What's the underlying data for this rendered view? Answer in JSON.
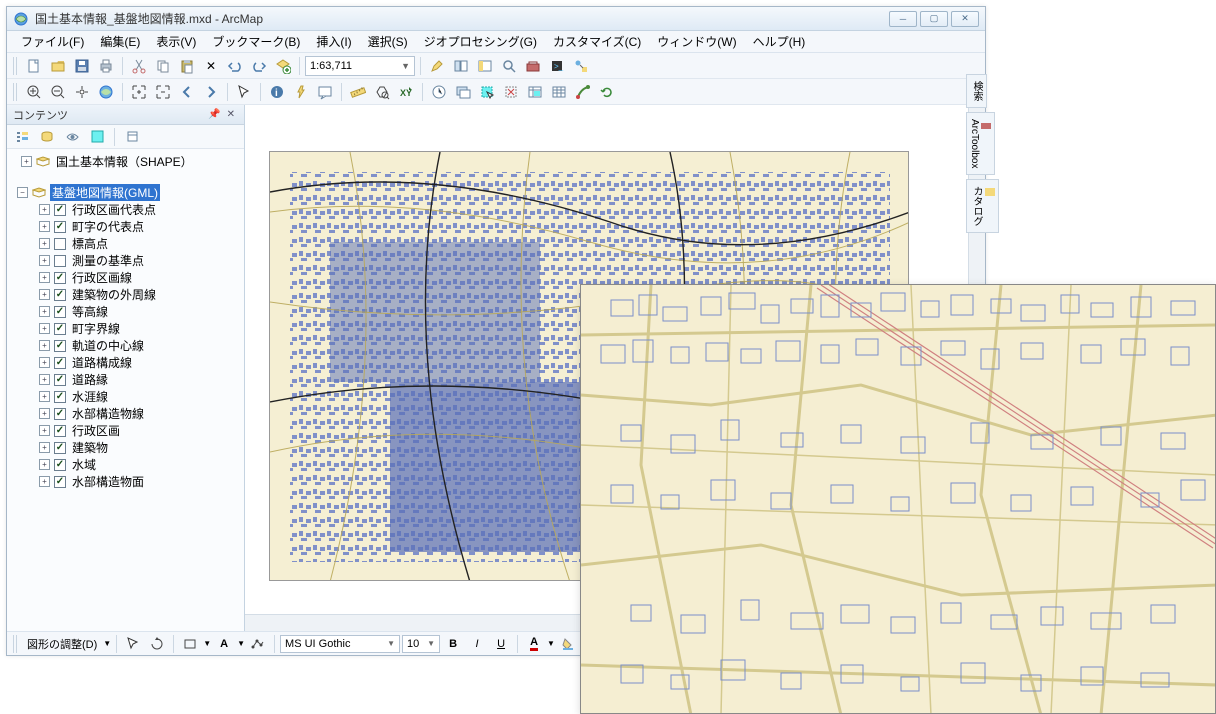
{
  "title": "国土基本情報_基盤地図情報.mxd - ArcMap",
  "menu": [
    "ファイル(F)",
    "編集(E)",
    "表示(V)",
    "ブックマーク(B)",
    "挿入(I)",
    "選択(S)",
    "ジオプロセシング(G)",
    "カスタマイズ(C)",
    "ウィンドウ(W)",
    "ヘルプ(H)"
  ],
  "scale": "1:63,711",
  "toc_title": "コンテンツ",
  "layer_group_1": {
    "label": "国土基本情報（SHAPE）"
  },
  "layer_group_2": {
    "label": "基盤地図情報(GML)",
    "selected": true
  },
  "layers": [
    {
      "label": "行政区画代表点",
      "checked": true
    },
    {
      "label": "町字の代表点",
      "checked": true
    },
    {
      "label": "標高点",
      "checked": false
    },
    {
      "label": "測量の基準点",
      "checked": false
    },
    {
      "label": "行政区画線",
      "checked": true
    },
    {
      "label": "建築物の外周線",
      "checked": true
    },
    {
      "label": "等高線",
      "checked": true
    },
    {
      "label": "町字界線",
      "checked": true
    },
    {
      "label": "軌道の中心線",
      "checked": true
    },
    {
      "label": "道路構成線",
      "checked": true
    },
    {
      "label": "道路縁",
      "checked": true
    },
    {
      "label": "水涯線",
      "checked": true
    },
    {
      "label": "水部構造物線",
      "checked": true
    },
    {
      "label": "行政区画",
      "checked": true
    },
    {
      "label": "建築物",
      "checked": true
    },
    {
      "label": "水域",
      "checked": true
    },
    {
      "label": "水部構造物面",
      "checked": true
    }
  ],
  "draw_label": "図形の調整(D)",
  "font_name": "MS UI Gothic",
  "font_size": "10",
  "side_tabs": [
    "検索",
    "ArcToolbox",
    "カタログ"
  ],
  "colors": {
    "accent": "#2f74d0",
    "map_bg": "#f5eed2",
    "building": "#6b7fc7",
    "road": "#c9b96a",
    "rail": "#c46b6b"
  }
}
